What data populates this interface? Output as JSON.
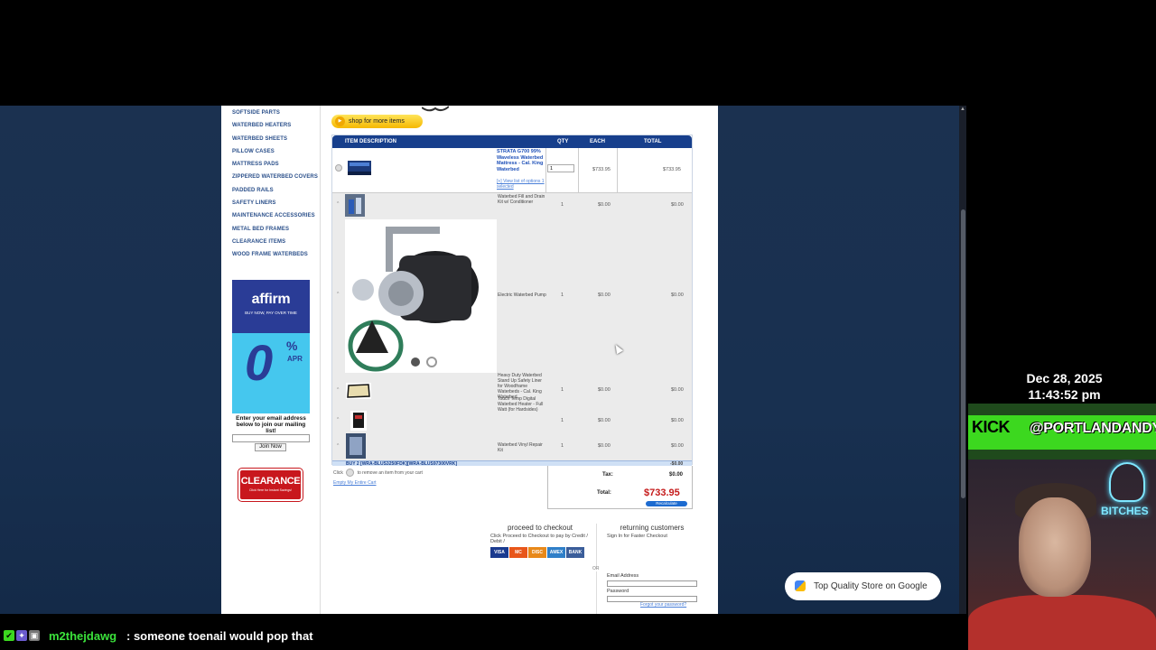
{
  "sidebar": {
    "categories": [
      "SOFTSIDE PARTS",
      "WATERBED HEATERS",
      "WATERBED SHEETS",
      "PILLOW CASES",
      "MATTRESS PADS",
      "ZIPPERED WATERBED COVERS",
      "PADDED RAILS",
      "SAFETY LINERS",
      "MAINTENANCE ACCESSORIES",
      "METAL BED FRAMES",
      "CLEARANCE ITEMS",
      "WOOD FRAME WATERBEDS"
    ],
    "affirm": {
      "logo": "affirm",
      "tagline": "BUY NOW, PAY OVER TIME",
      "zero": "0",
      "percent": "%",
      "apr": "APR"
    },
    "mailing_text": "Enter your email address below to join our mailing list!",
    "join_label": "Join Now",
    "clearance": {
      "title": "CLEARANCE",
      "subtitle": "Click Here for Instant Savings!"
    }
  },
  "shop_button": "shop for more items",
  "cart": {
    "headers": {
      "description": "ITEM DESCRIPTION",
      "qty": "QTY",
      "each": "EACH",
      "total": "TOTAL"
    },
    "main_item": {
      "title": "STRATA G700 99% Waveless Waterbed Mattress - Cal. King Waterbed",
      "options_link": "[+] View list of options 1 selected",
      "qty": "1",
      "each": "$733.95",
      "total": "$733.95"
    },
    "sub_items": [
      {
        "desc": "Waterbed Fill and Drain Kit w/ Conditioner",
        "qty": "1",
        "each": "$0.00",
        "total": "$0.00"
      },
      {
        "desc": "Electric Waterbed Pump",
        "qty": "1",
        "each": "$0.00",
        "total": "$0.00"
      },
      {
        "desc": "Heavy Duty Waterbed Stand Up Safety Liner for Woodframe Waterbeds - Cal. King Waterbed",
        "qty": "1",
        "each": "$0.00",
        "total": "$0.00"
      },
      {
        "desc": "Touch Temp Digital Waterbed Heater - Full Watt (for Hardsides)",
        "qty": "1",
        "each": "$0.00",
        "total": "$0.00"
      },
      {
        "desc": "Waterbed Vinyl Repair Kit",
        "qty": "1",
        "each": "$0.00",
        "total": "$0.00"
      }
    ],
    "buy_bar": "BUY 2 [WRA-BLUS3250FDK][WRA-BLUS97300VRK]",
    "buy_bar_value": "-$0.00",
    "remove_hint_prefix": "Click",
    "remove_hint": "to remove an item from your cart",
    "empty_cart": "Empty My Entire Cart"
  },
  "totals": {
    "tax_label": "Tax:",
    "tax_value": "$0.00",
    "total_label": "Total:",
    "total_value": "$733.95",
    "recalculate": "Recalculate"
  },
  "checkout": {
    "title": "proceed to checkout",
    "subtitle": "Click Proceed to Checkout to pay by Credit / Debit /",
    "cards": [
      "VISA",
      "MC",
      "DISC",
      "AMEX",
      "BANK"
    ],
    "or": "OR"
  },
  "returning": {
    "title": "returning customers",
    "subtitle": "Sign In for Faster Checkout",
    "email_label": "Email Address",
    "password_label": "Password",
    "forgot": "Forgot your password?"
  },
  "overlay": {
    "google_badge": "Top Quality Store on Google",
    "date": "Dec 28, 2025",
    "time": "11:43:52 pm",
    "kick_logo": "KICK",
    "kick_handle": "@PORTLANDANDY",
    "neon_text": "BITCHES",
    "chat_user": "m2thejdawg",
    "chat_message": ": someone toenail would pop that"
  },
  "colors": {
    "cart_header": "#173f8c",
    "total_red": "#c51a1a",
    "kick_green": "#3cd81f",
    "chat_user": "#3be23b"
  }
}
